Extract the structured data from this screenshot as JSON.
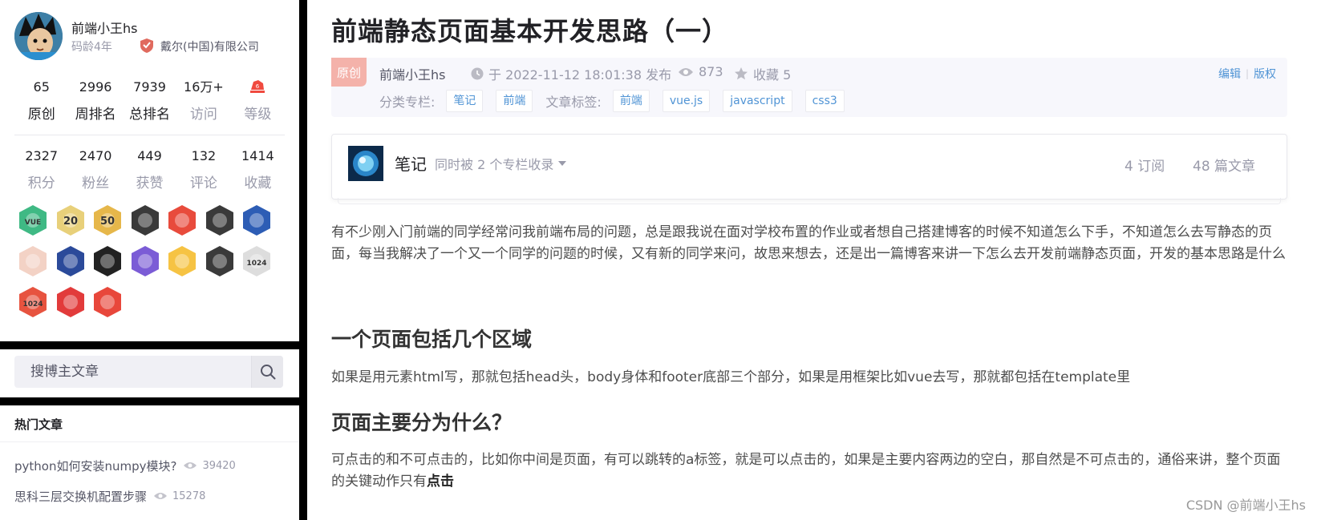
{
  "author": {
    "name": "前端小王hs",
    "code_age": "码龄4年",
    "company": "戴尔(中国)有限公司"
  },
  "stats_row1": [
    {
      "num": "65",
      "label": "原创",
      "dark": true
    },
    {
      "num": "2996",
      "label": "周排名",
      "dark": true
    },
    {
      "num": "7939",
      "label": "总排名",
      "dark": true
    },
    {
      "num": "16万+",
      "label": "访问",
      "dark": false
    },
    {
      "num": "",
      "label": "等级",
      "dark": false
    }
  ],
  "stats_row2": [
    {
      "num": "2327",
      "label": "积分"
    },
    {
      "num": "2470",
      "label": "粉丝"
    },
    {
      "num": "449",
      "label": "获赞"
    },
    {
      "num": "132",
      "label": "评论"
    },
    {
      "num": "1414",
      "label": "收藏"
    }
  ],
  "badges": [
    {
      "icon": "vue-badge-icon",
      "color": "#3fb984",
      "text": "VUE"
    },
    {
      "icon": "20-badge-icon",
      "color": "#e8d07a",
      "text": "20"
    },
    {
      "icon": "50-badge-icon",
      "color": "#e6b74a",
      "text": "50"
    },
    {
      "icon": "github-badge-icon",
      "color": "#3a3a3a",
      "text": ""
    },
    {
      "icon": "medal-badge-icon",
      "color": "#e84b3c",
      "text": ""
    },
    {
      "icon": "clock-badge-icon",
      "color": "#3a3a3a",
      "text": ""
    },
    {
      "icon": "astronaut-badge-icon",
      "color": "#2d5db5",
      "text": ""
    },
    {
      "icon": "monkey-badge-icon",
      "color": "#f3d2c5",
      "text": ""
    },
    {
      "icon": "rocket-badge-icon",
      "color": "#2b4a9a",
      "text": ""
    },
    {
      "icon": "book-badge-icon",
      "color": "#222222",
      "text": ""
    },
    {
      "icon": "cube-badge-icon",
      "color": "#7b5cd6",
      "text": ""
    },
    {
      "icon": "check-badge-icon",
      "color": "#f6c343",
      "text": ""
    },
    {
      "icon": "heng-badge-icon",
      "color": "#3a3a3a",
      "text": ""
    },
    {
      "icon": "1024-badge-icon",
      "color": "#dddddd",
      "text": "1024"
    },
    {
      "icon": "1024-red-badge-icon",
      "color": "#e7533f",
      "text": "1024"
    },
    {
      "icon": "pen-badge-icon",
      "color": "#e23b3b",
      "text": ""
    },
    {
      "icon": "monkey-red-badge-icon",
      "color": "#e8473b",
      "text": ""
    }
  ],
  "search": {
    "placeholder": "搜博主文章"
  },
  "hot": {
    "title": "热门文章",
    "items": [
      {
        "title": "python如何安装numpy模块?",
        "views": "39420"
      },
      {
        "title": "思科三层交换机配置步骤",
        "views": "15278"
      }
    ]
  },
  "article": {
    "title": "前端静态页面基本开发思路（一）",
    "original_tag": "原创",
    "author": "前端小王hs",
    "time": "于 2022-11-12 18:01:38 发布",
    "views": "873",
    "favorites": "收藏 5",
    "edit_label": "编辑",
    "copyright_label": "版权",
    "category_label": "分类专栏:",
    "categories": [
      "笔记",
      "前端"
    ],
    "tags_label": "文章标签:",
    "tags": [
      "前端",
      "vue.js",
      "javascript",
      "css3"
    ]
  },
  "column": {
    "name": "笔记",
    "included": "同时被 2 个专栏收录",
    "subscriptions": "4 订阅",
    "articles": "48 篇文章"
  },
  "body": {
    "p1": "有不少刚入门前端的同学经常问我前端布局的问题，总是跟我说在面对学校布置的作业或者想自己搭建博客的时候不知道怎么下手，不知道怎么去写静态的页面，每当我解决了一个又一个同学的问题的时候，又有新的同学来问，故思来想去，还是出一篇博客来讲一下怎么去开发前端静态页面，开发的基本思路是什么",
    "h1": "一个页面包括几个区域",
    "p2": "如果是用元素html写，那就包括head头，body身体和footer底部三个部分，如果是用框架比如vue去写，那就都包括在template里",
    "h2": "页面主要分为什么？",
    "p3": "可点击的和不可点击的，比如你中间是页面，有可以跳转的a标签，就是可以点击的，如果是主要内容两边的空白，那自然是不可点击的，通俗来讲，整个页面的关键动作只有",
    "p3_bold": "点击"
  },
  "watermark": "CSDN @前端小王hs"
}
